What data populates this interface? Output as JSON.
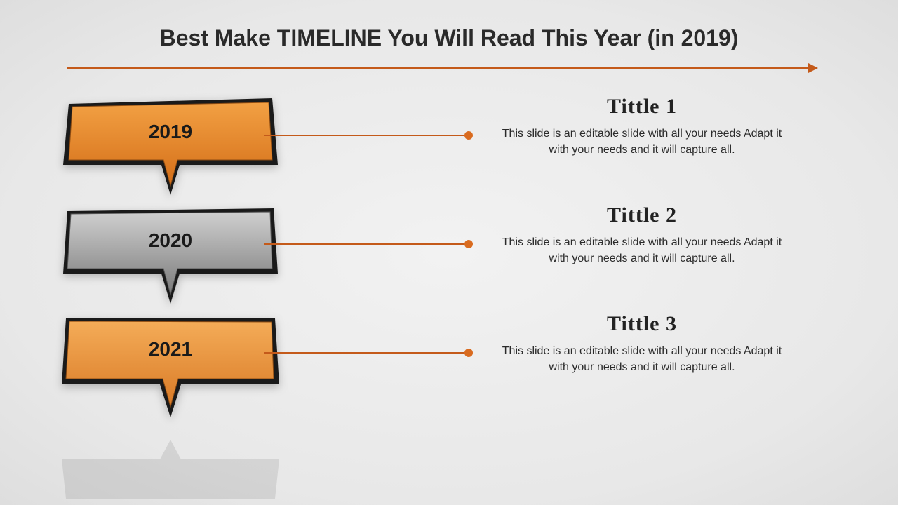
{
  "title": "Best Make TIMELINE You Will Read This Year (in 2019)",
  "colors": {
    "accent": "#c45a1a",
    "block_orange": "#e8872c",
    "block_gray": "#9e9e9e"
  },
  "items": [
    {
      "year": "2019",
      "title": "Tittle 1",
      "desc": "This slide is an editable slide with all your needs Adapt it with your needs and it will capture all."
    },
    {
      "year": "2020",
      "title": "Tittle 2",
      "desc": "This slide is an editable slide with all your needs Adapt it with your needs and it will capture all."
    },
    {
      "year": "2021",
      "title": "Tittle 3",
      "desc": "This slide is an editable slide with all your needs Adapt it with your needs and it will capture all."
    }
  ]
}
